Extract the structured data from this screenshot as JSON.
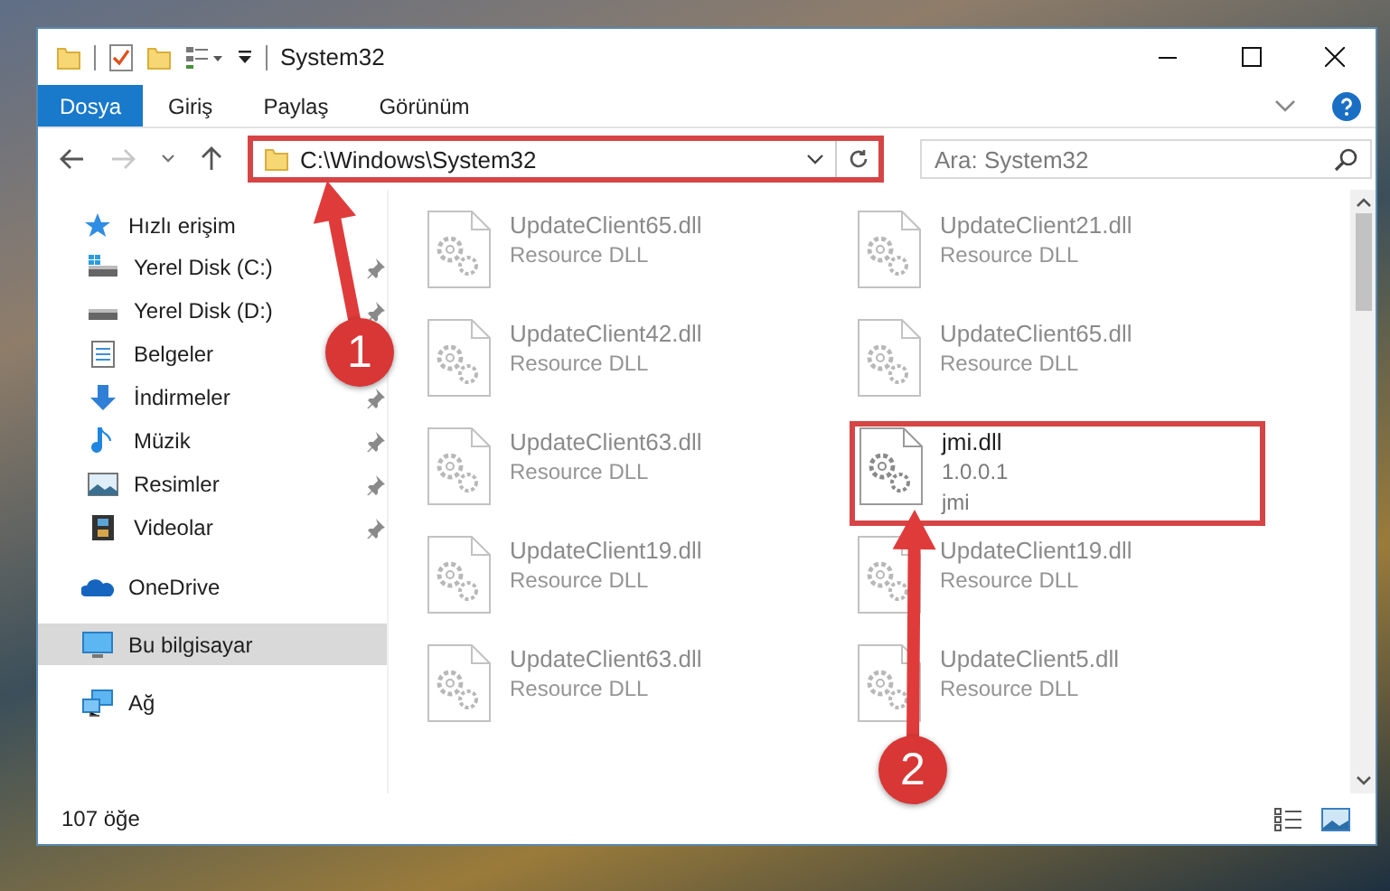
{
  "window": {
    "title": "System32"
  },
  "ribbon": {
    "tabs": [
      {
        "label": "Dosya",
        "kind": "file",
        "selected": false
      },
      {
        "label": "Giriş",
        "kind": "tab",
        "selected": false
      },
      {
        "label": "Paylaş",
        "kind": "tab",
        "selected": false
      },
      {
        "label": "Görünüm",
        "kind": "tab",
        "selected": false
      }
    ]
  },
  "address_bar": {
    "value": "C:\\Windows\\System32",
    "highlighted": true
  },
  "search": {
    "placeholder": "Ara: System32"
  },
  "sidebar": {
    "items": [
      {
        "label": "Hızlı erişim",
        "kind": "star",
        "selected": false,
        "children": [
          {
            "label": "Yerel Disk (C:)",
            "kind": "drive-windows",
            "selected": false,
            "pinned": true
          },
          {
            "label": "Yerel Disk (D:)",
            "kind": "drive",
            "selected": false,
            "pinned": true
          },
          {
            "label": "Belgeler",
            "kind": "documents",
            "selected": false
          },
          {
            "label": "İndirmeler",
            "kind": "download",
            "selected": false,
            "pinned": true
          },
          {
            "label": "Müzik",
            "kind": "music",
            "selected": false,
            "pinned": true
          },
          {
            "label": "Resimler",
            "kind": "pictures",
            "selected": false,
            "pinned": true
          },
          {
            "label": "Videolar",
            "kind": "videos",
            "selected": false,
            "pinned": true
          }
        ]
      },
      {
        "label": "OneDrive",
        "kind": "cloud",
        "selected": false
      },
      {
        "label": "Bu bilgisayar",
        "kind": "computer",
        "selected": true
      },
      {
        "label": "Ağ",
        "kind": "network",
        "selected": false
      }
    ]
  },
  "files": [
    {
      "name": "UpdateClient65.dll",
      "lines": [
        "Resource DLL"
      ],
      "faded": true,
      "highlighted": false
    },
    {
      "name": "UpdateClient21.dll",
      "lines": [
        "Resource DLL"
      ],
      "faded": true,
      "highlighted": false
    },
    {
      "name": "UpdateClient42.dll",
      "lines": [
        "Resource DLL"
      ],
      "faded": true,
      "highlighted": false
    },
    {
      "name": "UpdateClient65.dll",
      "lines": [
        "Resource DLL"
      ],
      "faded": true,
      "highlighted": false
    },
    {
      "name": "UpdateClient63.dll",
      "lines": [
        "Resource DLL"
      ],
      "faded": true,
      "highlighted": false
    },
    {
      "name": "jmi.dll",
      "lines": [
        "1.0.0.1",
        "jmi"
      ],
      "faded": false,
      "highlighted": true
    },
    {
      "name": "UpdateClient19.dll",
      "lines": [
        "Resource DLL"
      ],
      "faded": true,
      "highlighted": false
    },
    {
      "name": "UpdateClient19.dll",
      "lines": [
        "Resource DLL"
      ],
      "faded": true,
      "highlighted": false
    },
    {
      "name": "UpdateClient63.dll",
      "lines": [
        "Resource DLL"
      ],
      "faded": true,
      "highlighted": false
    },
    {
      "name": "UpdateClient5.dll",
      "lines": [
        "Resource DLL"
      ],
      "faded": true,
      "highlighted": false
    }
  ],
  "status_bar": {
    "item_count": "107 öğe"
  },
  "annotations": [
    {
      "label": "1"
    },
    {
      "label": "2"
    }
  ]
}
